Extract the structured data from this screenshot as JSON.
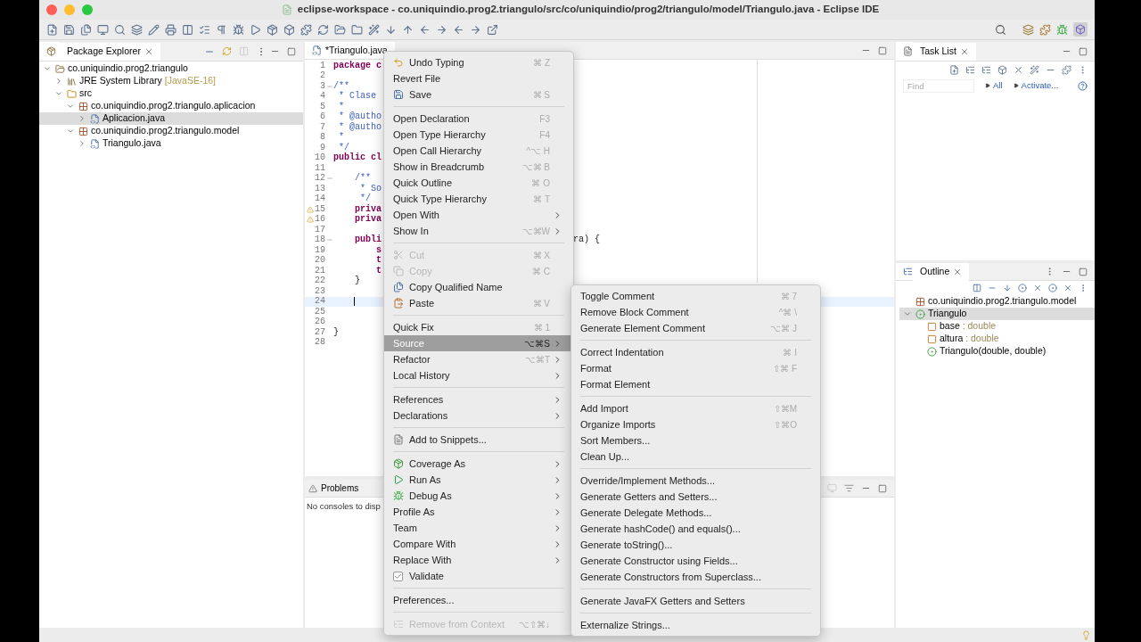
{
  "window": {
    "title": "eclipse-workspace - co.uniquindio.prog2.triangulo/src/co/uniquindio/prog2/triangulo/model/Triangulo.java - Eclipse IDE"
  },
  "package_explorer": {
    "title": "Package Explorer",
    "tree": [
      {
        "kind": "project",
        "label": "co.uniquindio.prog2.triangulo",
        "expanded": true,
        "selected": false,
        "children": [
          {
            "kind": "library",
            "label": "JRE System Library",
            "decoration": "[JavaSE-16]",
            "expanded": false,
            "selected": false
          },
          {
            "kind": "folder",
            "label": "src",
            "expanded": true,
            "selected": false,
            "children": [
              {
                "kind": "package",
                "label": "co.uniquindio.prog2.triangulo.aplicacion",
                "expanded": true,
                "selected": false,
                "children": [
                  {
                    "kind": "file",
                    "label": "Aplicacion.java",
                    "expanded": false,
                    "selected": true
                  }
                ]
              },
              {
                "kind": "package",
                "label": "co.uniquindio.prog2.triangulo.model",
                "expanded": true,
                "selected": false,
                "children": [
                  {
                    "kind": "file",
                    "label": "Triangulo.java",
                    "expanded": false,
                    "selected": false
                  }
                ]
              }
            ]
          }
        ]
      }
    ]
  },
  "editor": {
    "tabs": [
      {
        "label": "*Triangulo.java",
        "selected": true
      }
    ],
    "lines": [
      {
        "n": "1",
        "kind": "keyword",
        "text": "package c",
        "fold": false,
        "warning": false,
        "current": false
      },
      {
        "n": "2",
        "fold": false,
        "warning": false,
        "current": false
      },
      {
        "n": "3",
        "kind": "comment",
        "text": "/**",
        "fold": true,
        "warning": false,
        "current": false
      },
      {
        "n": "4",
        "kind": "comment",
        "text": " * Clase",
        "fold": false,
        "warning": false,
        "current": false
      },
      {
        "n": "5",
        "kind": "comment",
        "text": " *",
        "fold": false,
        "warning": false,
        "current": false
      },
      {
        "n": "6",
        "kind": "comment",
        "text": " * @autho",
        "fold": false,
        "warning": false,
        "current": false
      },
      {
        "n": "7",
        "kind": "comment",
        "text": " * @autho",
        "fold": false,
        "warning": false,
        "current": false
      },
      {
        "n": "8",
        "kind": "comment",
        "text": " *",
        "fold": false,
        "warning": false,
        "current": false
      },
      {
        "n": "9",
        "kind": "comment",
        "text": " */",
        "fold": false,
        "warning": false,
        "current": false
      },
      {
        "n": "10",
        "kind": "keyword",
        "text": "public cl",
        "fold": false,
        "warning": false,
        "current": false
      },
      {
        "n": "11",
        "fold": false,
        "warning": false,
        "current": false
      },
      {
        "n": "12",
        "kind": "comment",
        "text": "    /**",
        "fold": true,
        "warning": false,
        "current": false
      },
      {
        "n": "13",
        "kind": "comment",
        "text": "     * So",
        "fold": false,
        "warning": false,
        "current": false
      },
      {
        "n": "14",
        "kind": "comment",
        "text": "     */",
        "fold": false,
        "warning": false,
        "current": false
      },
      {
        "n": "15",
        "kind": "keyword",
        "text": "    priva",
        "fold": false,
        "warning": true,
        "current": false
      },
      {
        "n": "16",
        "kind": "keyword",
        "text": "    priva",
        "fold": false,
        "warning": true,
        "current": false
      },
      {
        "n": "17",
        "fold": false,
        "warning": false,
        "current": false
      },
      {
        "n": "18",
        "kind": "keyword",
        "text": "    publi",
        "tail": "ra) {",
        "fold": true,
        "warning": false,
        "current": false
      },
      {
        "n": "19",
        "kind": "keyword",
        "text": "        s",
        "fold": false,
        "warning": false,
        "current": false
      },
      {
        "n": "20",
        "kind": "keyword",
        "text": "        t",
        "fold": false,
        "warning": false,
        "current": false
      },
      {
        "n": "21",
        "kind": "keyword",
        "text": "        t",
        "fold": false,
        "warning": false,
        "current": false
      },
      {
        "n": "22",
        "kind": "plain",
        "text": "    }",
        "fold": false,
        "warning": false,
        "current": false
      },
      {
        "n": "23",
        "fold": false,
        "warning": false,
        "current": false
      },
      {
        "n": "24",
        "fold": false,
        "warning": false,
        "current": true
      },
      {
        "n": "25",
        "fold": false,
        "warning": false,
        "current": false
      },
      {
        "n": "26",
        "fold": false,
        "warning": false,
        "current": false
      },
      {
        "n": "27",
        "kind": "plain",
        "text": "}",
        "fold": false,
        "warning": false,
        "current": false
      },
      {
        "n": "28",
        "fold": false,
        "warning": false,
        "current": false
      }
    ]
  },
  "bottom_panel": {
    "tabs": [
      {
        "label": "Problems",
        "selected": false
      }
    ],
    "message": "No consoles to disp"
  },
  "task_list": {
    "title": "Task List",
    "find_placeholder": "Find",
    "links": [
      "All",
      "Activate..."
    ]
  },
  "outline": {
    "title": "Outline",
    "tree": [
      {
        "kind": "package",
        "label": "co.uniquindio.prog2.triangulo.model",
        "selected": false
      },
      {
        "kind": "class",
        "label": "Triangulo",
        "expanded": true,
        "selected": true,
        "children": [
          {
            "kind": "field",
            "label": "base",
            "type": " : double",
            "selected": false
          },
          {
            "kind": "field",
            "label": "altura",
            "type": " : double",
            "selected": false
          },
          {
            "kind": "constructor",
            "label": "Triangulo(double, double)",
            "selected": false
          }
        ]
      }
    ]
  },
  "context_menu": {
    "items": [
      {
        "kind": "item",
        "label": "Undo Typing",
        "shortcut": "⌘ Z",
        "submenu": false,
        "disabled": false,
        "selected": false
      },
      {
        "kind": "item",
        "label": "Revert File",
        "submenu": false,
        "disabled": false,
        "selected": false
      },
      {
        "kind": "item",
        "label": "Save",
        "shortcut": "⌘ S",
        "submenu": false,
        "disabled": false,
        "selected": false
      },
      {
        "kind": "separator"
      },
      {
        "kind": "item",
        "label": "Open Declaration",
        "shortcut": "F3",
        "submenu": false,
        "disabled": false,
        "selected": false
      },
      {
        "kind": "item",
        "label": "Open Type Hierarchy",
        "shortcut": "F4",
        "submenu": false,
        "disabled": false,
        "selected": false
      },
      {
        "kind": "item",
        "label": "Open Call Hierarchy",
        "shortcut": "^⌥ H",
        "submenu": false,
        "disabled": false,
        "selected": false
      },
      {
        "kind": "item",
        "label": "Show in Breadcrumb",
        "shortcut": "⌥⌘ B",
        "submenu": false,
        "disabled": false,
        "selected": false
      },
      {
        "kind": "item",
        "label": "Quick Outline",
        "shortcut": "⌘ O",
        "submenu": false,
        "disabled": false,
        "selected": false
      },
      {
        "kind": "item",
        "label": "Quick Type Hierarchy",
        "shortcut": "⌘ T",
        "submenu": false,
        "disabled": false,
        "selected": false
      },
      {
        "kind": "item",
        "label": "Open With",
        "submenu": true,
        "disabled": false,
        "selected": false
      },
      {
        "kind": "item",
        "label": "Show In",
        "shortcut": "⌥⌘W",
        "submenu": true,
        "disabled": false,
        "selected": false
      },
      {
        "kind": "separator"
      },
      {
        "kind": "item",
        "label": "Cut",
        "shortcut": "⌘ X",
        "submenu": false,
        "disabled": true,
        "selected": false
      },
      {
        "kind": "item",
        "label": "Copy",
        "shortcut": "⌘ C",
        "submenu": false,
        "disabled": true,
        "selected": false
      },
      {
        "kind": "item",
        "label": "Copy Qualified Name",
        "submenu": false,
        "disabled": false,
        "selected": false
      },
      {
        "kind": "item",
        "label": "Paste",
        "shortcut": "⌘ V",
        "submenu": false,
        "disabled": false,
        "selected": false
      },
      {
        "kind": "separator"
      },
      {
        "kind": "item",
        "label": "Quick Fix",
        "shortcut": "⌘ 1",
        "submenu": false,
        "disabled": false,
        "selected": false
      },
      {
        "kind": "item",
        "label": "Source",
        "shortcut": "⌥⌘S",
        "submenu": true,
        "disabled": false,
        "selected": true
      },
      {
        "kind": "item",
        "label": "Refactor",
        "shortcut": "⌥⌘T",
        "submenu": true,
        "disabled": false,
        "selected": false
      },
      {
        "kind": "item",
        "label": "Local History",
        "submenu": true,
        "disabled": false,
        "selected": false
      },
      {
        "kind": "separator"
      },
      {
        "kind": "item",
        "label": "References",
        "submenu": true,
        "disabled": false,
        "selected": false
      },
      {
        "kind": "item",
        "label": "Declarations",
        "submenu": true,
        "disabled": false,
        "selected": false
      },
      {
        "kind": "separator"
      },
      {
        "kind": "item",
        "label": "Add to Snippets...",
        "submenu": false,
        "disabled": false,
        "selected": false
      },
      {
        "kind": "separator"
      },
      {
        "kind": "item",
        "label": "Coverage As",
        "submenu": true,
        "disabled": false,
        "selected": false
      },
      {
        "kind": "item",
        "label": "Run As",
        "submenu": true,
        "disabled": false,
        "selected": false
      },
      {
        "kind": "item",
        "label": "Debug As",
        "submenu": true,
        "disabled": false,
        "selected": false
      },
      {
        "kind": "item",
        "label": "Profile As",
        "submenu": true,
        "disabled": false,
        "selected": false
      },
      {
        "kind": "item",
        "label": "Team",
        "submenu": true,
        "disabled": false,
        "selected": false
      },
      {
        "kind": "item",
        "label": "Compare With",
        "submenu": true,
        "disabled": false,
        "selected": false
      },
      {
        "kind": "item",
        "label": "Replace With",
        "submenu": true,
        "disabled": false,
        "selected": false
      },
      {
        "kind": "check",
        "label": "Validate",
        "checked": true,
        "submenu": false,
        "disabled": false,
        "selected": false
      },
      {
        "kind": "separator"
      },
      {
        "kind": "item",
        "label": "Preferences...",
        "submenu": false,
        "disabled": false,
        "selected": false
      },
      {
        "kind": "separator"
      },
      {
        "kind": "item",
        "label": "Remove from Context",
        "shortcut": "⌥⇧⌘↓",
        "submenu": false,
        "disabled": true,
        "selected": false
      }
    ]
  },
  "source_submenu": {
    "items": [
      {
        "kind": "item",
        "label": "Toggle Comment",
        "shortcut": "⌘ 7",
        "selected": false
      },
      {
        "kind": "item",
        "label": "Remove Block Comment",
        "shortcut": "^⌘ \\",
        "selected": false
      },
      {
        "kind": "item",
        "label": "Generate Element Comment",
        "shortcut": "⌥⌘ J",
        "selected": false
      },
      {
        "kind": "separator"
      },
      {
        "kind": "item",
        "label": "Correct Indentation",
        "shortcut": "⌘ I",
        "selected": false
      },
      {
        "kind": "item",
        "label": "Format",
        "shortcut": "⇧⌘ F",
        "selected": false
      },
      {
        "kind": "item",
        "label": "Format Element",
        "selected": false
      },
      {
        "kind": "separator"
      },
      {
        "kind": "item",
        "label": "Add Import",
        "shortcut": "⇧⌘M",
        "selected": false
      },
      {
        "kind": "item",
        "label": "Organize Imports",
        "shortcut": "⇧⌘O",
        "selected": false
      },
      {
        "kind": "item",
        "label": "Sort Members...",
        "selected": false
      },
      {
        "kind": "item",
        "label": "Clean Up...",
        "selected": false
      },
      {
        "kind": "separator"
      },
      {
        "kind": "item",
        "label": "Override/Implement Methods...",
        "selected": false
      },
      {
        "kind": "item",
        "label": "Generate Getters and Setters...",
        "selected": false
      },
      {
        "kind": "item",
        "label": "Generate Delegate Methods...",
        "selected": false
      },
      {
        "kind": "item",
        "label": "Generate hashCode() and equals()...",
        "selected": false
      },
      {
        "kind": "item",
        "label": "Generate toString()...",
        "selected": false
      },
      {
        "kind": "item",
        "label": "Generate Constructor using Fields...",
        "selected": false
      },
      {
        "kind": "item",
        "label": "Generate Constructors from Superclass...",
        "selected": false
      },
      {
        "kind": "separator"
      },
      {
        "kind": "item",
        "label": "Generate JavaFX Getters and Setters",
        "selected": false
      },
      {
        "kind": "separator"
      },
      {
        "kind": "item",
        "label": "Externalize Strings...",
        "selected": false
      }
    ]
  }
}
